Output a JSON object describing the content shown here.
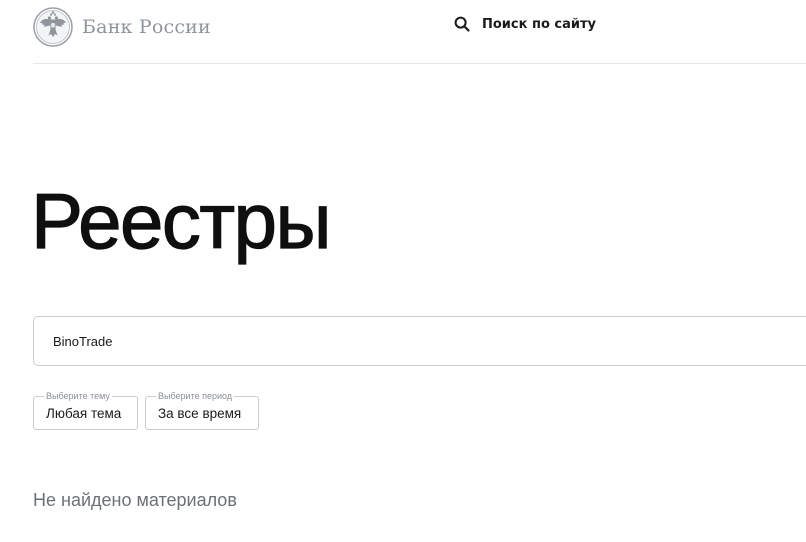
{
  "header": {
    "logo_text": "Банк России",
    "search_label": "Поиск по сайту"
  },
  "main": {
    "title": "Реестры",
    "search": {
      "value": "BinoTrade",
      "placeholder": ""
    },
    "filters": [
      {
        "legend": "Выберите тему",
        "value": "Любая тема"
      },
      {
        "legend": "Выберите период",
        "value": "За все время"
      }
    ],
    "empty_message": "Не найдено материалов"
  },
  "icons": {
    "logo": "double-headed-eagle-emblem-icon",
    "search": "search-icon"
  },
  "colors": {
    "logo_gray": "#8f959c",
    "text": "#1a1a1a",
    "border": "#c9cdd2",
    "muted": "#6b7178"
  }
}
